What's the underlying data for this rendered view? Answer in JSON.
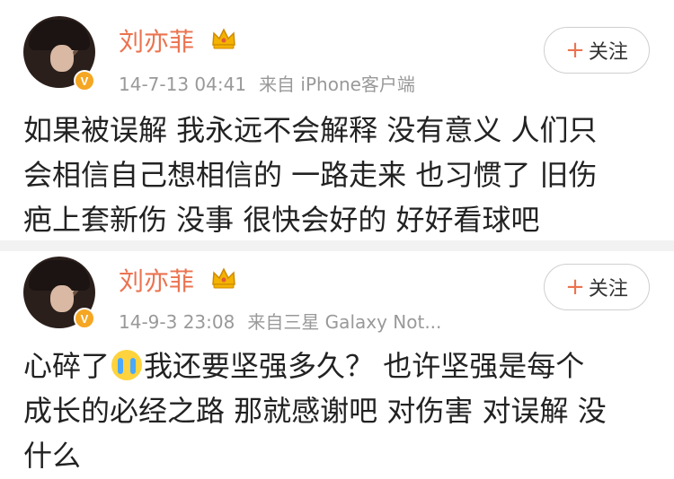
{
  "posts": [
    {
      "user_name": "刘亦菲",
      "timestamp": "14-7-13 04:41",
      "source": "来自 iPhone客户端",
      "follow_label": "关注",
      "text": "如果被误解 我永远不会解释 没有意义 人们只\n会相信自己想相信的 一路走来 也习惯了 旧伤\n疤上套新伤 没事 很快会好的 好好看球吧"
    },
    {
      "user_name": "刘亦菲",
      "timestamp": "14-9-3 23:08",
      "source": "来自三星 Galaxy Not...",
      "follow_label": "关注",
      "text_before_emoji": "心碎了",
      "text_after_emoji": "我还要坚强多久？ 也许坚强是每个\n成长的必经之路 那就感谢吧 对伤害 对误解 没\n什么"
    }
  ],
  "icons": {
    "verified_badge": "V",
    "crown": "crown-icon",
    "follow_plus": "+",
    "emoji": "crying-emoji-icon"
  },
  "colors": {
    "name": "#eb7350",
    "badge": "#f5a623",
    "meta": "#999999",
    "text": "#222222",
    "divider": "#f2f2f2"
  }
}
